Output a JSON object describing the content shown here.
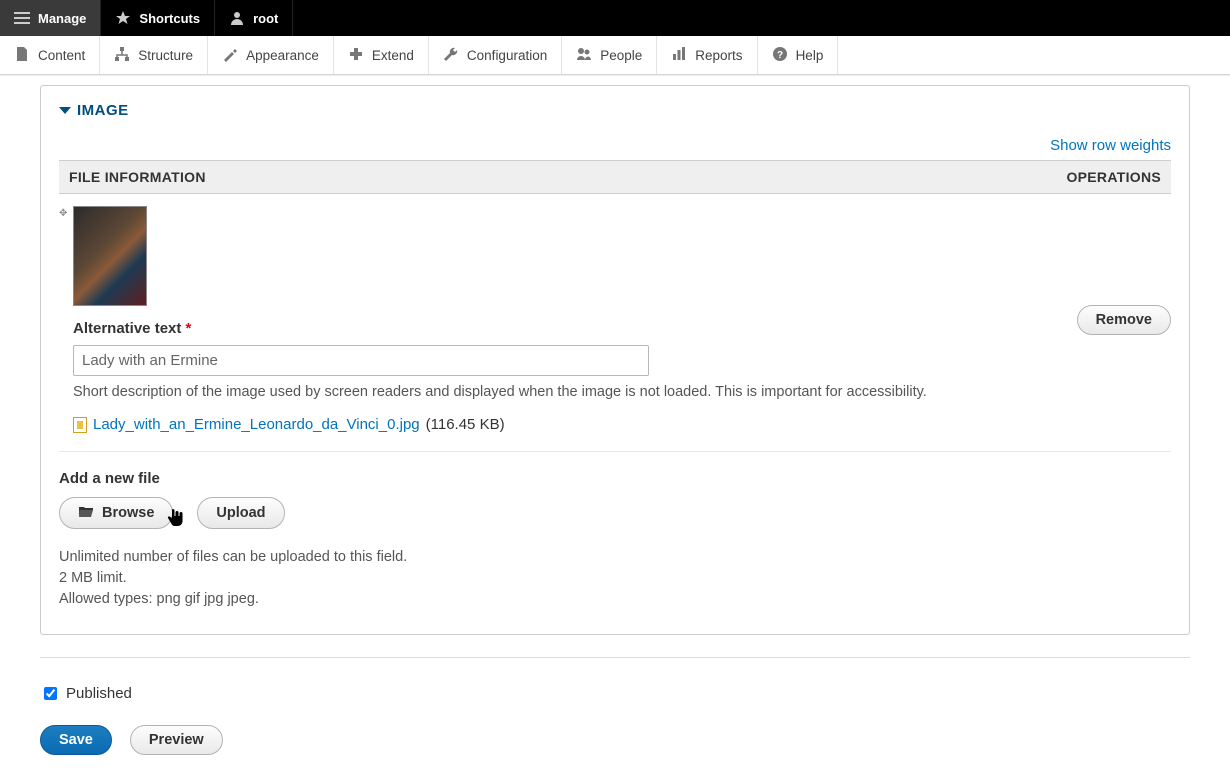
{
  "topbar": {
    "manage": "Manage",
    "shortcuts": "Shortcuts",
    "user": "root"
  },
  "adminbar": {
    "content": "Content",
    "structure": "Structure",
    "appearance": "Appearance",
    "extend": "Extend",
    "configuration": "Configuration",
    "people": "People",
    "reports": "Reports",
    "help": "Help"
  },
  "fieldset": {
    "legend": "IMAGE",
    "show_row_weights": "Show row weights",
    "th_file_info": "FILE INFORMATION",
    "th_ops": "OPERATIONS",
    "remove": "Remove",
    "alt_label": "Alternative text",
    "alt_value": "Lady with an Ermine",
    "alt_desc": "Short description of the image used by screen readers and displayed when the image is not loaded. This is important for accessibility.",
    "file_name": "Lady_with_an_Ermine_Leonardo_da_Vinci_0.jpg",
    "file_size": "(116.45 KB)",
    "add_new_label": "Add a new file",
    "browse": "Browse",
    "upload": "Upload",
    "hint1": "Unlimited number of files can be uploaded to this field.",
    "hint2": "2 MB limit.",
    "hint3": "Allowed types: png gif jpg jpeg."
  },
  "footer": {
    "published": "Published",
    "save": "Save",
    "preview": "Preview"
  }
}
